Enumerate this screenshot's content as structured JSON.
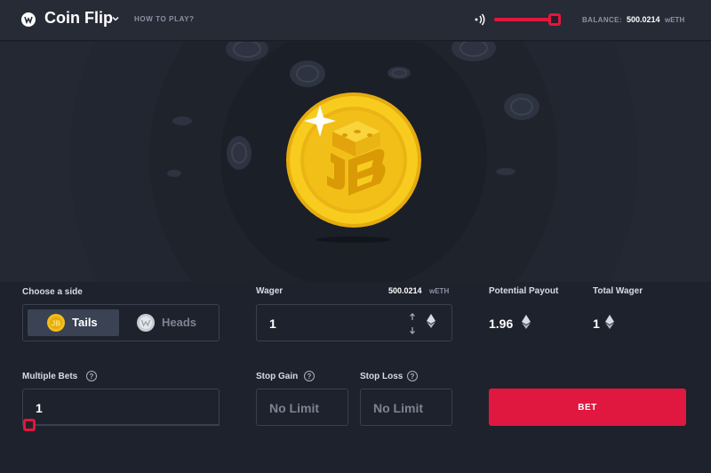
{
  "header": {
    "title": "Coin Flip",
    "how_to_play": "HOW TO PLAY?",
    "balance_label": "BALANCE:",
    "balance_value": "500.0214",
    "balance_unit": "wETH",
    "volume_level": 0.95
  },
  "side": {
    "label": "Choose a side",
    "options": [
      {
        "label": "Tails",
        "selected": true
      },
      {
        "label": "Heads",
        "selected": false
      }
    ]
  },
  "wager": {
    "label": "Wager",
    "balance_value": "500.0214",
    "balance_unit": "wETH",
    "value": "1"
  },
  "payout": {
    "label": "Potential Payout",
    "value": "1.96"
  },
  "total_wager": {
    "label": "Total Wager",
    "value": "1"
  },
  "multiple_bets": {
    "label": "Multiple Bets",
    "value": "1",
    "help": "?"
  },
  "stop_gain": {
    "label": "Stop Gain",
    "placeholder": "No Limit",
    "help": "?"
  },
  "stop_loss": {
    "label": "Stop Loss",
    "placeholder": "No Limit",
    "help": "?"
  },
  "bet_button": {
    "label": "BET"
  },
  "colors": {
    "accent": "#e0173f",
    "background": "#1e222c",
    "topbar": "#262b36",
    "coin_gold": "#f5c518"
  },
  "icons": {
    "logo": "coin-logo-icon",
    "volume": "volume-icon",
    "eth": "ethereum-icon",
    "help": "help-circle-icon",
    "tails_coin": "tails-coin-icon",
    "heads_coin": "heads-coin-icon"
  }
}
